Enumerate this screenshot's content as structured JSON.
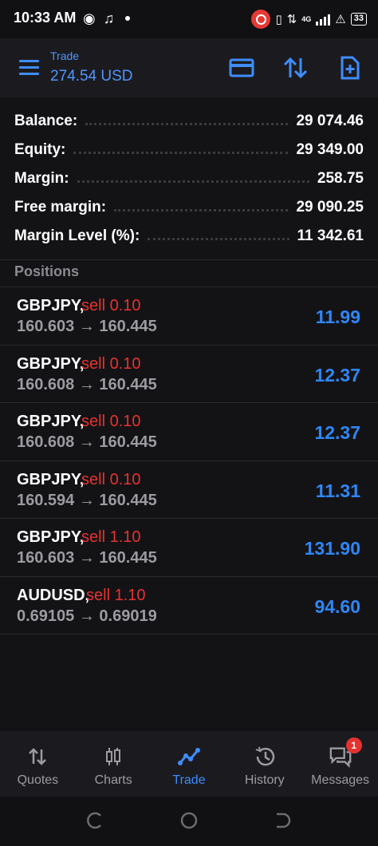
{
  "status_bar": {
    "time": "10:33 AM",
    "network_label": "4G",
    "battery": "33",
    "icons": [
      "screen-record-icon",
      "music-icon",
      "vibrate-icon",
      "data-icon",
      "signal-icon",
      "alert-icon",
      "battery-icon"
    ]
  },
  "header": {
    "subtitle": "Trade",
    "title": "274.54 USD",
    "icons": [
      "menu-icon",
      "card-icon",
      "sort-icon",
      "new-order-icon"
    ],
    "accent_color": "#4f95ff"
  },
  "summary": [
    {
      "label": "Balance:",
      "value": "29 074.46"
    },
    {
      "label": "Equity:",
      "value": "29 349.00"
    },
    {
      "label": "Margin:",
      "value": "258.75"
    },
    {
      "label": "Free margin:",
      "value": "29 090.25"
    },
    {
      "label": "Margin Level (%):",
      "value": "11 342.61"
    }
  ],
  "positions_label": "Positions",
  "positions": [
    {
      "symbol": "GBPJPY,",
      "side": "sell 0.10",
      "open": "160.603",
      "arrow": "→",
      "current": "160.445",
      "profit": "11.99"
    },
    {
      "symbol": "GBPJPY,",
      "side": "sell 0.10",
      "open": "160.608",
      "arrow": "→",
      "current": "160.445",
      "profit": "12.37"
    },
    {
      "symbol": "GBPJPY,",
      "side": "sell 0.10",
      "open": "160.608",
      "arrow": "→",
      "current": "160.445",
      "profit": "12.37"
    },
    {
      "symbol": "GBPJPY,",
      "side": "sell 0.10",
      "open": "160.594",
      "arrow": "→",
      "current": "160.445",
      "profit": "11.31"
    },
    {
      "symbol": "GBPJPY,",
      "side": "sell 1.10",
      "open": "160.603",
      "arrow": "→",
      "current": "160.445",
      "profit": "131.90"
    },
    {
      "symbol": "AUDUSD,",
      "side": "sell 1.10",
      "open": "0.69105",
      "arrow": "→",
      "current": "0.69019",
      "profit": "94.60"
    }
  ],
  "colors": {
    "sell": "#e5332f",
    "profit": "#2f86f6",
    "background": "#131316"
  },
  "bottom_nav": [
    {
      "label": "Quotes",
      "icon": "quotes-icon",
      "active": false
    },
    {
      "label": "Charts",
      "icon": "charts-icon",
      "active": false
    },
    {
      "label": "Trade",
      "icon": "trade-icon",
      "active": true
    },
    {
      "label": "History",
      "icon": "history-icon",
      "active": false
    },
    {
      "label": "Messages",
      "icon": "messages-icon",
      "active": false,
      "badge": "1"
    }
  ],
  "system_nav": [
    "recent-apps-icon",
    "home-icon",
    "back-icon"
  ]
}
